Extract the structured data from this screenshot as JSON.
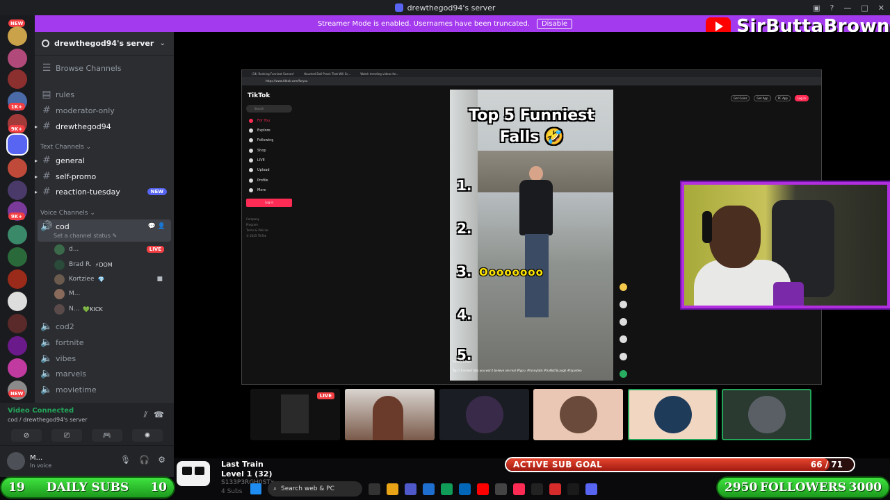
{
  "window": {
    "title": "drewthegod94's server"
  },
  "streamer_banner": {
    "text": "Streamer Mode is enabled. Usernames have been truncated.",
    "button": "Disable"
  },
  "brand": {
    "name": "SirButtaBrown"
  },
  "server_list": {
    "badges": [
      {
        "text": "NEW",
        "top": 0
      },
      {
        "text": "1K+",
        "top": 0
      },
      {
        "text": "9K+",
        "top": 0
      },
      {
        "text": "9K+",
        "top": 0
      },
      {
        "text": "NEW",
        "top": 0
      }
    ]
  },
  "sidebar": {
    "server_name": "drewthegod94's server",
    "browse": "Browse Channels",
    "top_channels": [
      "rules",
      "moderator-only",
      "drewthegod94"
    ],
    "text_category": "Text Channels",
    "text_channels": [
      "general",
      "self-promo",
      "reaction-tuesday"
    ],
    "new_pill": "NEW",
    "voice_category": "Voice Channels",
    "active_voice": "cod",
    "channel_status": "Set a channel status",
    "voice_users": [
      {
        "name": "d...",
        "tag": "",
        "live": "LIVE"
      },
      {
        "name": "Brad R.",
        "tag": "⚡DOM",
        "live": ""
      },
      {
        "name": "Kortziee",
        "tag": "💎",
        "live": ""
      },
      {
        "name": "M...",
        "tag": "",
        "live": ""
      },
      {
        "name": "N...",
        "tag": "💚KICK",
        "live": ""
      }
    ],
    "other_voice": [
      "cod2",
      "fortnite",
      "vibes",
      "marvels",
      "movietime"
    ]
  },
  "voice_panel": {
    "title": "Video Connected",
    "subtitle": "cod / drewthegod94's server"
  },
  "user_panel": {
    "name": "M...",
    "status": "In voice"
  },
  "tiktok": {
    "tabs": [
      "(34) Ranking Funniest Scenes!",
      "Haunted Doll Prank That Will Sc...",
      "Watch trending videos for..."
    ],
    "url": "https://www.tiktok.com/foryou",
    "logo": "TikTok",
    "search": "Search",
    "nav": [
      "For You",
      "Explore",
      "Following",
      "Shop",
      "LIVE",
      "Upload",
      "Profile",
      "More"
    ],
    "login": "Log in",
    "footer": [
      "Company",
      "Program",
      "Terms & Policies",
      "© 2025 TikTok"
    ],
    "top_buttons": [
      "Get Coins",
      "Get App",
      "PC App",
      "Log in"
    ]
  },
  "video": {
    "title_line1": "Top 5 Funniest",
    "title_line2": "Falls 🤣",
    "numbers": [
      "1.",
      "2.",
      "3.",
      "4.",
      "5."
    ],
    "answer": "Oooooooo",
    "caption_user": "funniest_tops",
    "caption": "Top 5 funniest falls you won't believe are real #fypシ #funnyfails #tryNotToLaugh #topvideo"
  },
  "tiles": {
    "live_label": "LIVE"
  },
  "sub_goal": {
    "label": "ACTIVE SUB GOAL",
    "count": "66 / 71",
    "current": 66,
    "target": 71
  },
  "train": {
    "title": "Last Train",
    "level": "Level 1  (32)",
    "user": "S133P3RGH0STx",
    "subs": "4 Subs"
  },
  "daily_subs": {
    "left": "19",
    "label": "DAILY SUBS",
    "right": "10"
  },
  "followers": {
    "left": "2950",
    "label": "FOLLOWERS",
    "right": "3000"
  },
  "taskbar": {
    "search": "Search web & PC"
  }
}
